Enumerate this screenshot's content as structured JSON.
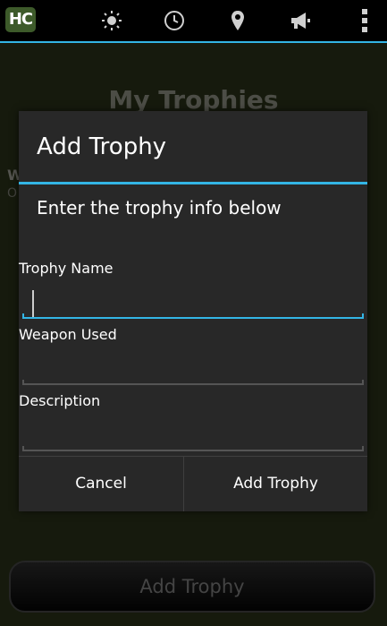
{
  "actionbar": {
    "logo": "HC",
    "icons": [
      "sun-icon",
      "clock-icon",
      "map-pin-icon",
      "megaphone-icon",
      "overflow-menu-icon"
    ]
  },
  "background": {
    "title": "My Trophies",
    "peek_line1": "W",
    "peek_line2": "O",
    "add_button": "Add Trophy"
  },
  "dialog": {
    "title": "Add Trophy",
    "message": "Enter the trophy info below",
    "fields": [
      {
        "label": "Trophy Name",
        "value": ""
      },
      {
        "label": "Weapon Used",
        "value": ""
      },
      {
        "label": "Description",
        "value": ""
      }
    ],
    "cancel_label": "Cancel",
    "confirm_label": "Add Trophy"
  },
  "colors": {
    "accent": "#33b5e5",
    "dialog_bg": "#282828",
    "actionbar_bg": "#000000"
  }
}
